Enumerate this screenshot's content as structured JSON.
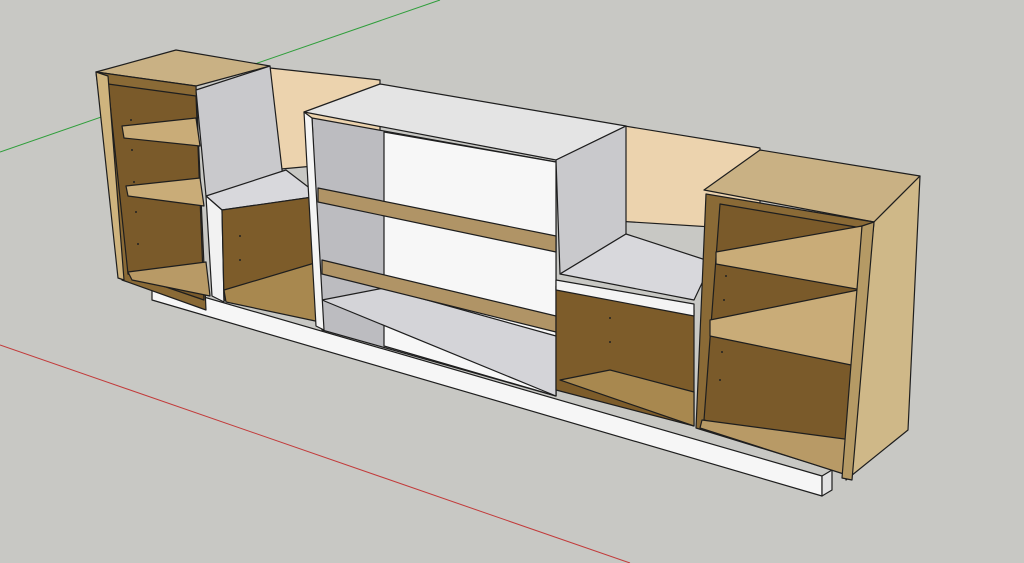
{
  "app": {
    "view": "3d-model-viewport"
  },
  "scene": {
    "model": "cabinet-console",
    "axes": {
      "green": "#2e9e3a",
      "red": "#c23a3a"
    },
    "colors": {
      "background": "#c8c8c4",
      "wood_face": "#cfb888",
      "wood_light": "#e8d0ad",
      "wood_dark": "#7a5a2a",
      "carcass_white": "#f4f4f4",
      "carcass_grey": "#c9c9cc",
      "edge": "#1e1e1e"
    }
  }
}
